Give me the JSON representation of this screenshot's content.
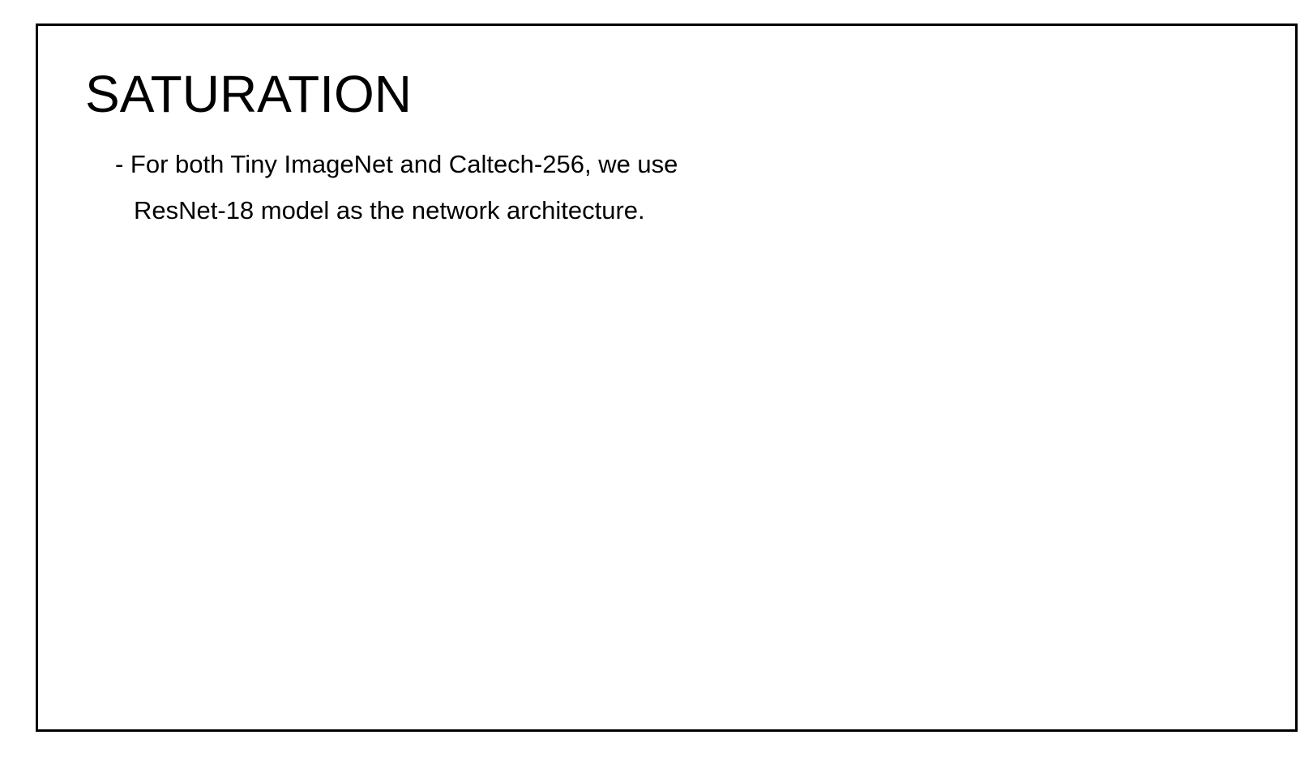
{
  "slide": {
    "title": "SATURATION",
    "bullet": {
      "line1": "- For both Tiny ImageNet and Caltech-256, we use",
      "line2": "ResNet-18 model as the network architecture."
    }
  }
}
